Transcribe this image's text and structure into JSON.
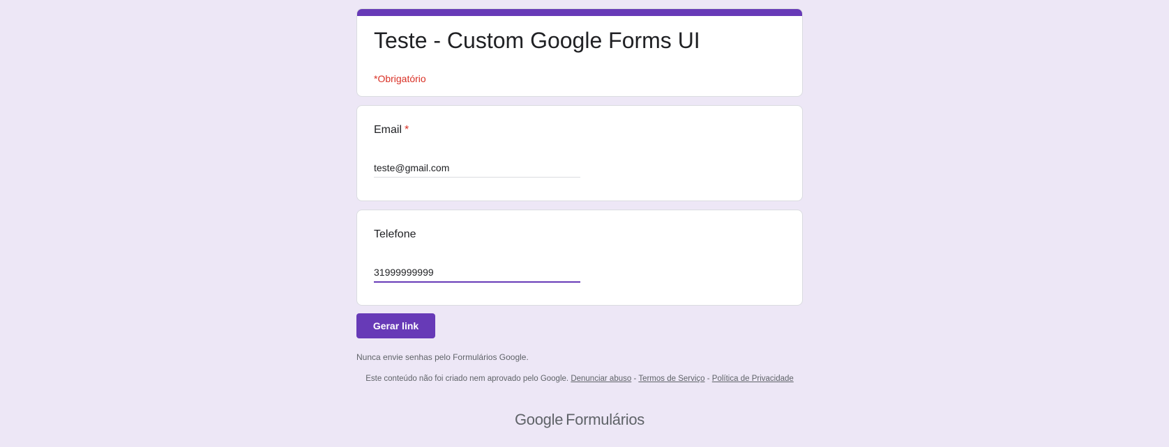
{
  "form": {
    "title": "Teste - Custom Google Forms UI",
    "required_note": "*Obrigatório",
    "accent_color": "#673ab7",
    "required_color": "#d93025"
  },
  "questions": [
    {
      "label": "Email",
      "required_marker": "*",
      "value": "teste@gmail.com"
    },
    {
      "label": "Telefone",
      "value": "31999999999"
    }
  ],
  "actions": {
    "submit_label": "Gerar link"
  },
  "footer": {
    "warning": "Nunca envie senhas pelo Formulários Google.",
    "disclaimer_prefix": "Este conteúdo não foi criado nem aprovado pelo Google.",
    "report_abuse_link": "Denunciar abuso",
    "separator": "-",
    "terms_link": "Termos de Serviço",
    "privacy_link": "Política de Privacidade",
    "brand_google": "Google",
    "brand_product": "Formulários"
  }
}
